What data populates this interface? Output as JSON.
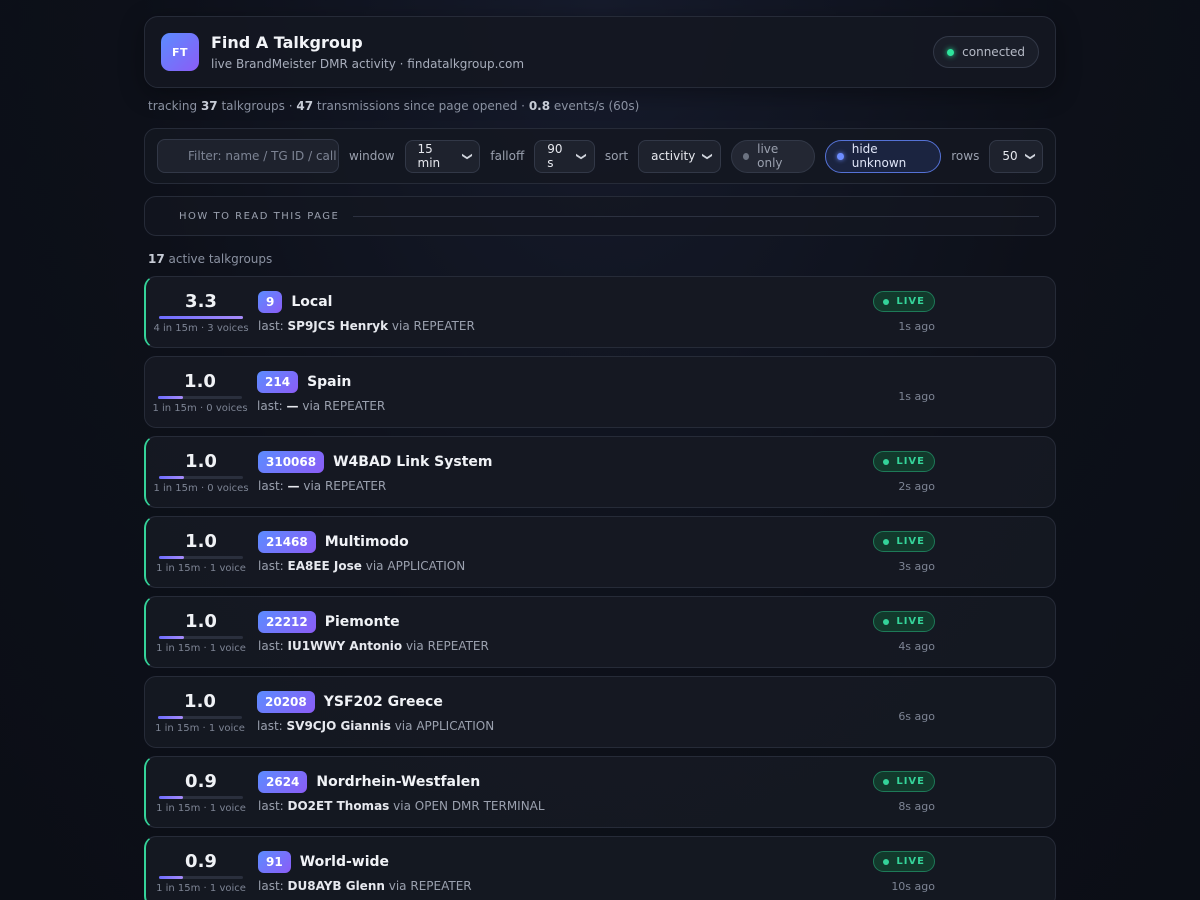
{
  "header": {
    "logo_text": "FT",
    "title": "Find A Talkgroup",
    "subtitle": "live BrandMeister DMR activity · findatalkgroup.com",
    "connection_status": "connected"
  },
  "stats": {
    "prefix": "tracking",
    "talkgroups": "37",
    "talkgroups_label": "talkgroups ·",
    "transmissions": "47",
    "transmissions_label": "transmissions since page opened ·",
    "events_rate": "0.8",
    "events_label": "events/s (60s)"
  },
  "controls": {
    "filter_placeholder": "Filter: name / TG ID / call",
    "window_label": "window",
    "window_value": "15 min",
    "falloff_label": "falloff",
    "falloff_value": "90 s",
    "sort_label": "sort",
    "sort_value": "activity",
    "live_only_label": "live only",
    "hide_unknown_label": "hide unknown",
    "rows_label": "rows",
    "rows_value": "50"
  },
  "howto": {
    "label": "HOW TO READ THIS PAGE"
  },
  "summary": {
    "count": "17",
    "label": "active talkgroups"
  },
  "labels": {
    "last_prefix": "last:",
    "via": "via",
    "live": "LIVE"
  },
  "colors": {
    "accent_start": "#5b8cff",
    "accent_end": "#8b5cf6",
    "live_green": "#34d399",
    "connected_dot": "#2ee59d"
  },
  "talkgroups": [
    {
      "score": "3.3",
      "activity": 1.0,
      "meta": "4 in 15m · 3 voices",
      "id": "9",
      "name": "Local",
      "last_call": "SP9JCS Henryk",
      "via": "REPEATER",
      "live": true,
      "ago": "1s ago"
    },
    {
      "score": "1.0",
      "activity": 0.3,
      "meta": "1 in 15m · 0 voices",
      "id": "214",
      "name": "Spain",
      "last_call": "—",
      "via": "REPEATER",
      "live": false,
      "ago": "1s ago"
    },
    {
      "score": "1.0",
      "activity": 0.3,
      "meta": "1 in 15m · 0 voices",
      "id": "310068",
      "name": "W4BAD Link System",
      "last_call": "—",
      "via": "REPEATER",
      "live": true,
      "ago": "2s ago"
    },
    {
      "score": "1.0",
      "activity": 0.3,
      "meta": "1 in 15m · 1 voice",
      "id": "21468",
      "name": "Multimodo",
      "last_call": "EA8EE Jose",
      "via": "APPLICATION",
      "live": true,
      "ago": "3s ago"
    },
    {
      "score": "1.0",
      "activity": 0.3,
      "meta": "1 in 15m · 1 voice",
      "id": "22212",
      "name": "Piemonte",
      "last_call": "IU1WWY Antonio",
      "via": "REPEATER",
      "live": true,
      "ago": "4s ago"
    },
    {
      "score": "1.0",
      "activity": 0.3,
      "meta": "1 in 15m · 1 voice",
      "id": "20208",
      "name": "YSF202 Greece",
      "last_call": "SV9CJO Giannis",
      "via": "APPLICATION",
      "live": false,
      "ago": "6s ago"
    },
    {
      "score": "0.9",
      "activity": 0.28,
      "meta": "1 in 15m · 1 voice",
      "id": "2624",
      "name": "Nordrhein-Westfalen",
      "last_call": "DO2ET Thomas",
      "via": "OPEN DMR TERMINAL",
      "live": true,
      "ago": "8s ago"
    },
    {
      "score": "0.9",
      "activity": 0.28,
      "meta": "1 in 15m · 1 voice",
      "id": "91",
      "name": "World-wide",
      "last_call": "DU8AYB Glenn",
      "via": "REPEATER",
      "live": true,
      "ago": "10s ago"
    }
  ]
}
